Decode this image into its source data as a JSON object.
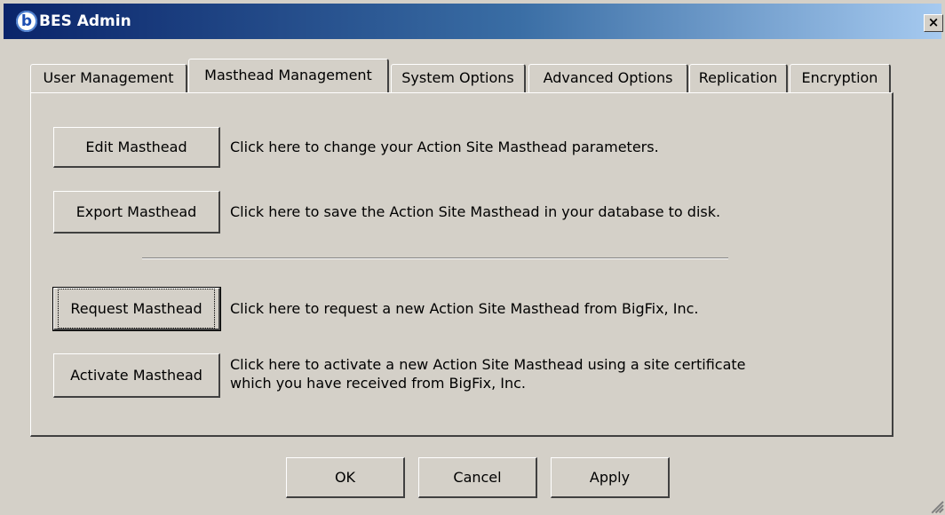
{
  "window": {
    "title": "BES Admin",
    "close_glyph": "×"
  },
  "tabs": [
    {
      "label": "User Management"
    },
    {
      "label": "Masthead Management",
      "active": true
    },
    {
      "label": "System Options"
    },
    {
      "label": "Advanced Options"
    },
    {
      "label": "Replication"
    },
    {
      "label": "Encryption"
    }
  ],
  "actions": {
    "edit": {
      "button": "Edit Masthead",
      "description": "Click here to change your Action Site Masthead parameters."
    },
    "export": {
      "button": "Export Masthead",
      "description": "Click here to save the Action Site Masthead in your database to disk."
    },
    "request": {
      "button": "Request Masthead",
      "description": "Click here to request a new Action Site Masthead from BigFix, Inc."
    },
    "activate": {
      "button": "Activate Masthead",
      "description_line1": "Click here to activate a new Action Site Masthead using a site certificate",
      "description_line2": "which you have received from BigFix, Inc."
    }
  },
  "footer": {
    "ok": "OK",
    "cancel": "Cancel",
    "apply": "Apply"
  },
  "icons": {
    "app": "bigfix-b-icon",
    "close": "close-icon",
    "resize": "resize-grip-icon"
  },
  "colors": {
    "titlebar_start": "#0a246a",
    "titlebar_end": "#a6caf0",
    "face": "#d4d0c8"
  }
}
